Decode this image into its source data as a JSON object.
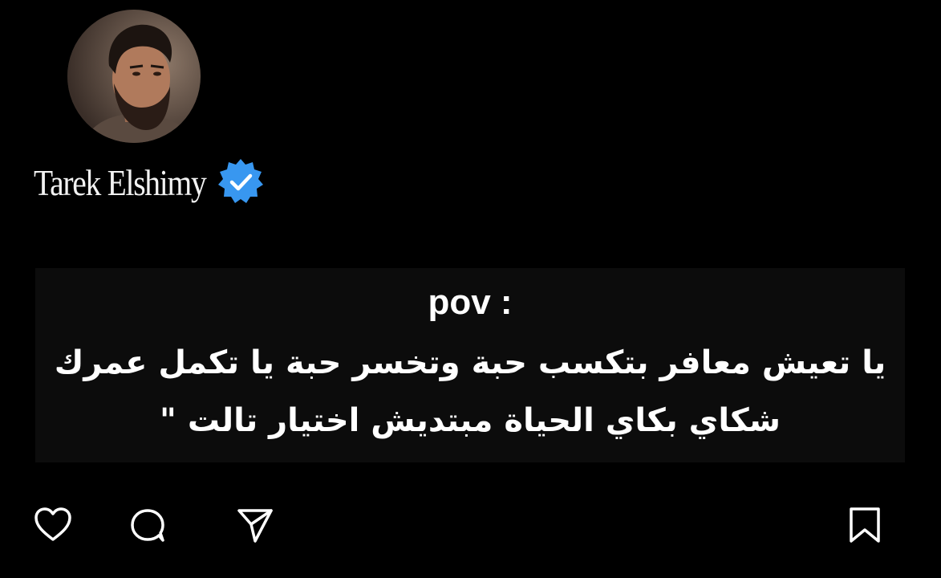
{
  "post": {
    "author": {
      "name": "Tarek Elshimy",
      "verified_icon": "verified-badge-icon",
      "verified_color": "#3897f0"
    },
    "caption": {
      "title": "pov :",
      "line1": "يا تعيش معافر بتكسب حبة وتخسر حبة يا تكمل عمرك",
      "line2": "شكاي بكاي الحياة مبتديش اختيار تالت \""
    },
    "actions": {
      "like_icon": "heart-icon",
      "comment_icon": "comment-bubble-icon",
      "share_icon": "paper-plane-icon",
      "save_icon": "bookmark-icon"
    }
  },
  "colors": {
    "background": "#000000",
    "caption_background": "#0c0c0c",
    "text": "#ffffff"
  }
}
